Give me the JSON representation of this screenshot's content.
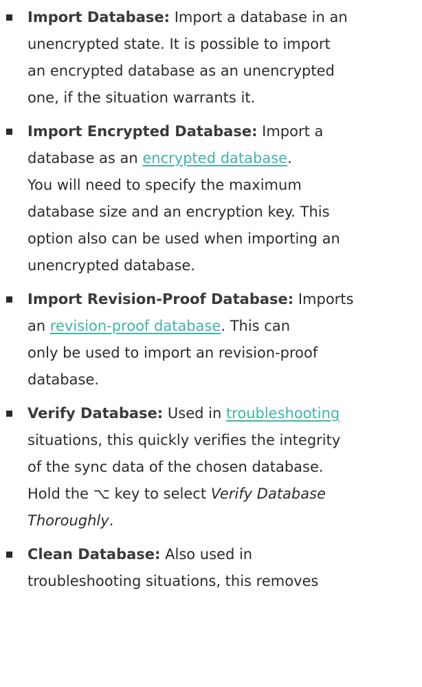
{
  "items": [
    {
      "term": "Import Database:",
      "line1": " Import a database in an",
      "line2": "unencrypted state. It is possible to import",
      "line3": "an encrypted database as an unencrypted",
      "line4": "one, if the situation warrants it."
    },
    {
      "term": "Import Encrypted Database:",
      "line1": " Import a",
      "line2_pre": "database as an ",
      "line2_link": "encrypted database",
      "line2_post": ".",
      "line3": "You will need to specify the maximum",
      "line4": "database size and an encryption key. This",
      "line5": "option also can be used when importing an",
      "line6": "unencrypted database."
    },
    {
      "term": "Import Revision-Proof Database:",
      "line1": " Imports",
      "line2_pre": "an ",
      "line2_link": "revision-proof database",
      "line2_post": ". This can",
      "line3": "only be used to import an revision-proof",
      "line4": "database."
    },
    {
      "term": "Verify Database:",
      "line1_pre": " Used in ",
      "line1_link": "troubleshooting",
      "line2": "situations, this quickly verifies the integrity",
      "line3": "of the sync data of the chosen database.",
      "line4_pre": "Hold the ⌥ key to select ",
      "line4_em": "Verify Database",
      "line5_em": "Thoroughly",
      "line5_post": "."
    },
    {
      "term": "Clean Database:",
      "line1": " Also used in",
      "line2": "troubleshooting situations, this removes"
    }
  ]
}
